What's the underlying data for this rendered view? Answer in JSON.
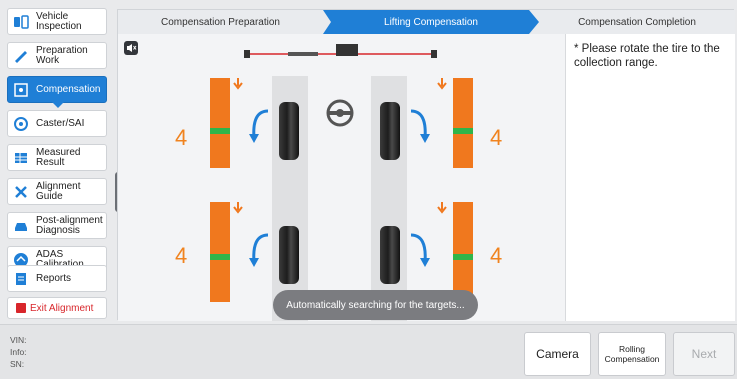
{
  "sidebar": {
    "items": [
      {
        "label": "Vehicle Inspection",
        "icon": "car-seat-icon"
      },
      {
        "label": "Preparation Work",
        "icon": "wrench-icon"
      },
      {
        "label": "Compensation",
        "icon": "target-icon"
      },
      {
        "label": "Caster/SAI",
        "icon": "wheel-icon"
      },
      {
        "label": "Measured Result",
        "icon": "table-icon"
      },
      {
        "label": "Alignment Guide",
        "icon": "tools-icon"
      },
      {
        "label": "Post-alignment Diagnosis",
        "icon": "car-diagnosis-icon"
      },
      {
        "label": "ADAS Calibration",
        "icon": "adas-icon"
      },
      {
        "label": "Reports",
        "icon": "report-icon"
      }
    ],
    "exit_label": "Exit Alignment"
  },
  "steps": [
    "Compensation Preparation",
    "Lifting Compensation",
    "Compensation Completion"
  ],
  "active_step": 1,
  "wheel_values": {
    "front_left": "4",
    "front_right": "4",
    "rear_left": "4",
    "rear_right": "4"
  },
  "instruction": "* Please rotate the tire to the collection range.",
  "toast": "Automatically searching for the targets...",
  "footer": {
    "vin_label": "VIN:",
    "info_label": "Info:",
    "sn_label": "SN:",
    "camera_label": "Camera",
    "rolling_label": "Rolling Compensation",
    "next_label": "Next"
  },
  "colors": {
    "accent": "#1f7fd6",
    "orange": "#f0781e",
    "green": "#2fb54a",
    "exit_red": "#d8262b"
  }
}
